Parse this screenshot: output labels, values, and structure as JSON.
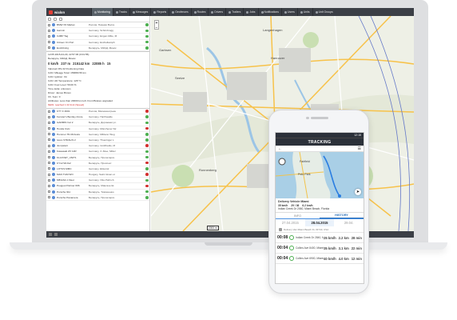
{
  "app": {
    "logo_text": "wialon",
    "nav": [
      {
        "label": "Monitoring",
        "active": true
      },
      {
        "label": "Tracks"
      },
      {
        "label": "Messages"
      },
      {
        "label": "Reports"
      },
      {
        "label": "Geofences"
      },
      {
        "label": "Routes"
      },
      {
        "label": "Drivers"
      },
      {
        "label": "Trailers"
      },
      {
        "label": "Jobs"
      },
      {
        "label": "Notifications"
      },
      {
        "label": "Users"
      },
      {
        "label": "Units"
      },
      {
        "label": "Unit Groups"
      }
    ]
  },
  "units_top": [
    {
      "name": "BMW X6 Market",
      "address": "Россия, Нижняя Волга",
      "status": "#4caf50"
    },
    {
      "name": "Garmin",
      "address": "Germany, Schönbrugg",
      "status": "#4caf50"
    },
    {
      "name": "CABP Tag",
      "address": "Germany, Engen-Mitte, M",
      "status": "#4caf50"
    },
    {
      "name": "Citroen C1 Port",
      "address": "Germany, Eschelkamph",
      "status": "#4caf50"
    },
    {
      "name": "EcoDriving",
      "address": "Беларусь, МКАД, Минск",
      "status": "#4caf50"
    }
  ],
  "details": {
    "timestamp": "12:05 2015-04-29, 22:57:06 (0:01:55)",
    "location": "Беларусь, МКАД, Минск",
    "stats": [
      "0 km/h",
      "237 m",
      "215142 km",
      "22085 h",
      "15"
    ],
    "lines": [
      "Valsmart RS-32 Positioning Data",
      "CAN: Mileage Total: 156880.56 km",
      "CAN: Ignition: On",
      "CAN: AD Temperature: 128 °C",
      "CAN: Fuel Level: 59.00 %",
      "Time delta: unknown",
      "Driver: James Brown",
      "Ch. Sum: 0",
      "Attributes: Less than 20000 km left. Front Brakes upgraded"
    ],
    "alert": "NEW: reached 1 02 limit (Speed)"
  },
  "units_bottom": [
    {
      "name": "KTY F 4601",
      "address": "Россия, Мясникентрьян",
      "status": "#d32f2f"
    },
    {
      "name": "Fenster's Bentley Azure",
      "address": "Germany, Harthwalde",
      "status": "#4caf50"
    },
    {
      "name": "GARMIN Cel 2",
      "address": "Беларусь, Дорожная ул.",
      "status": "#4caf50"
    },
    {
      "name": "Honda Civic",
      "address": "Germany, Münchener Str.",
      "status": "#d32f2f"
    },
    {
      "name": "Hummer H1 McGuire",
      "address": "Germany, Mittlerer Weg",
      "status": "#4caf50"
    },
    {
      "name": "Iveco STRALIS 2",
      "address": "Germany, Thueringer L",
      "status": "#4caf50"
    },
    {
      "name": "Jumpstart",
      "address": "Germany, Großheide, M",
      "status": "#d32f2f"
    },
    {
      "name": "Kawasaki ZX 12R",
      "address": "Germany, 3. Allee, Mittel",
      "status": "#4caf50"
    },
    {
      "name": "KLAXVET_UNIT1",
      "address": "Беларусь, Пролетарск.",
      "status": "#4caf50"
    },
    {
      "name": "KY12 WUG2",
      "address": "Беларусь, Проспект",
      "status": "#d32f2f"
    },
    {
      "name": "LOTUS MMC",
      "address": "Germany, Elsterstr.",
      "status": "#4caf50"
    },
    {
      "name": "MAN TGM WO",
      "address": "Hungary, Saint Istvan ut",
      "status": "#d32f2f"
    },
    {
      "name": "MB ESA 1 Fleet",
      "address": "Germany, Otto-Hahn-S",
      "status": "#4caf50"
    },
    {
      "name": "Peugeot Partner 006",
      "address": "Беларусь, Минское Ш.",
      "status": "#d32f2f"
    },
    {
      "name": "Porsche 911",
      "address": "Беларусь, Тимошенко",
      "status": "#4caf50"
    },
    {
      "name": "Porsche Panamera",
      "address": "Беларусь, Пролетарск.",
      "status": "#4caf50"
    }
  ],
  "map": {
    "labels": [
      "Hannover",
      "Laatzen",
      "Seelze",
      "Ronnenberg",
      "Langenhagen",
      "Garbsen"
    ],
    "scale": "2000 m",
    "bottom_text": "© Gurtam"
  },
  "phone": {
    "status_time": "12:15",
    "title": "TRACKING",
    "map_labels": [
      "Fairfield",
      "Polo Park"
    ],
    "unit_name": "Delivery Vehicle Miami",
    "unit_nums": [
      "35 km/h",
      "29 / 36",
      "6.2 km/h"
    ],
    "unit_address": "Indian Creek Dr 2060, Miami Beach, Florida",
    "tabs": [
      "INFO",
      "HISTORY"
    ],
    "dates": [
      "27.04.2015",
      "28.04.2015",
      "29.04."
    ],
    "parked": "Delivery Van Miami Beach FL 33740, USA",
    "trips": [
      {
        "time": "00:08",
        "desc": "Indian Creek Dr 2840, Miami Beach",
        "v1": "25 km/h",
        "v2": "2.2 km",
        "v3": "28 min"
      },
      {
        "time": "00:04",
        "desc": "Collins Ave 8400, Miami Beach FL",
        "v1": "35 km/h",
        "v2": "3.1 km",
        "v3": "22 min"
      },
      {
        "time": "00:04",
        "desc": "Collins Ave 6900, Miami Beach FL",
        "v1": "40 km/h",
        "v2": "4.0 km",
        "v3": "12 min"
      }
    ]
  },
  "colors": {
    "accent": "#e03e36",
    "ok": "#4caf50",
    "alert": "#d32f2f",
    "topbar": "#3b3f46"
  }
}
